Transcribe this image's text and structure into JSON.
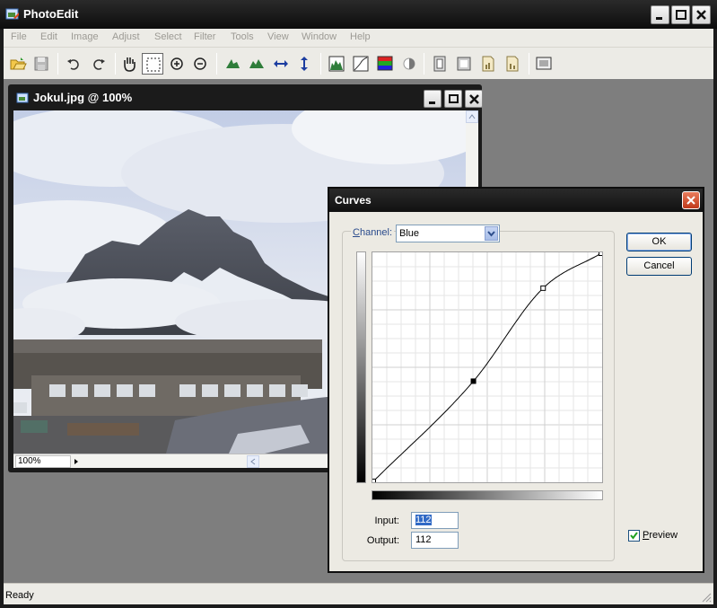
{
  "app": {
    "title": "PhotoEdit"
  },
  "menu": [
    "File",
    "Edit",
    "Image",
    "Adjust",
    "Select",
    "Filter",
    "Tools",
    "View",
    "Window",
    "Help"
  ],
  "toolbar": {
    "tools": [
      "open-icon",
      "save-icon",
      "undo-icon",
      "redo-icon",
      "hand-icon",
      "marquee-icon",
      "zoom-in-icon",
      "zoom-out-icon",
      "rotate-left-icon",
      "rotate-right-icon",
      "flip-horizontal-icon",
      "flip-vertical-icon",
      "levels-icon",
      "curves-icon",
      "color-balance-icon",
      "brightness-icon",
      "frame-icon",
      "canvas-size-icon",
      "image-size-icon",
      "resample-icon",
      "fit-screen-icon"
    ]
  },
  "document": {
    "title": "Jokul.jpg @ 100%",
    "zoom": "100%"
  },
  "curves": {
    "title": "Curves",
    "channel_label_accel": "C",
    "channel_label_rest": "hannel:",
    "channel_value": "Blue",
    "input_label": "Input:",
    "input_value": "112",
    "output_label": "Output:",
    "output_value": "112",
    "ok_label": "OK",
    "cancel_label": "Cancel",
    "preview_label_accel": "P",
    "preview_label_rest": "review",
    "preview_checked": true,
    "control_points": [
      [
        0,
        0
      ],
      [
        112,
        112
      ],
      [
        190,
        216
      ],
      [
        255,
        255
      ]
    ],
    "selected_point": 1
  },
  "status": {
    "text": "Ready"
  }
}
